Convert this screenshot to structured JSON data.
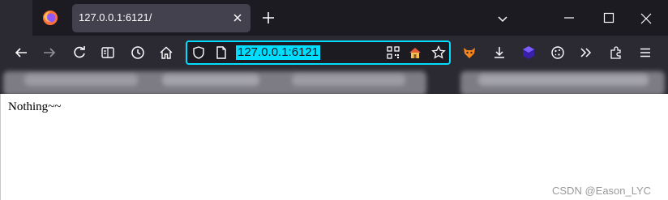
{
  "tab": {
    "title": "127.0.0.1:6121/"
  },
  "urlbar": {
    "url": "127.0.0.1:6121"
  },
  "page": {
    "body_text": "Nothing~~"
  },
  "watermark": "CSDN @Eason_LYC",
  "colors": {
    "tabstrip_bg": "#1c1b22",
    "toolbar_bg": "#2b2a33",
    "active_tab_bg": "#42414d",
    "urlbar_focus_border": "#00ddff",
    "url_selection_bg": "#00ddff",
    "icon_fg": "#fbfbfe"
  },
  "icons": [
    "firefox-logo-icon",
    "close-tab-icon",
    "new-tab-icon",
    "list-all-tabs-icon",
    "minimize-icon",
    "maximize-icon",
    "close-window-icon",
    "back-icon",
    "forward-icon",
    "reload-icon",
    "reader-view-icon",
    "history-icon",
    "home-icon",
    "tracking-shield-icon",
    "page-info-icon",
    "qr-code-icon",
    "home-shortcut-icon",
    "bookmark-star-icon",
    "extension-fox-icon",
    "downloads-icon",
    "extension-cube-icon",
    "cookie-icon",
    "overflow-chevron-icon",
    "extensions-puzzle-icon",
    "app-menu-icon"
  ]
}
